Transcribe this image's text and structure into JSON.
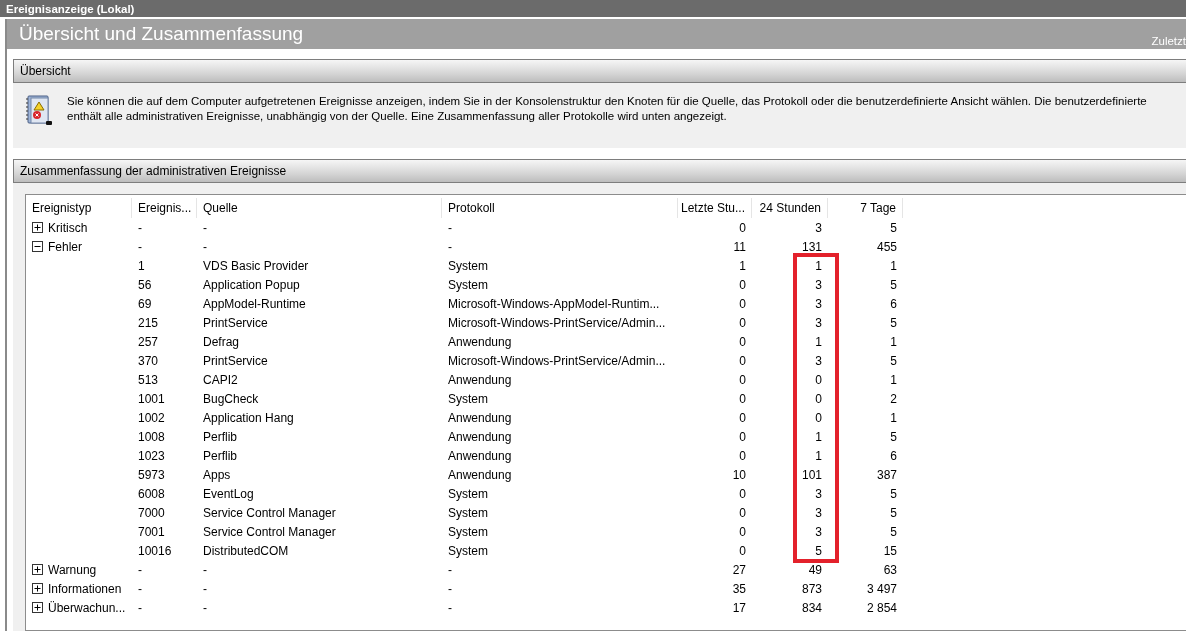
{
  "window": {
    "title": "Ereignisanzeige (Lokal)"
  },
  "panel": {
    "title": "Übersicht und Zusammenfassung",
    "last_refreshed": "Zuletzt"
  },
  "overview": {
    "title": "Übersicht",
    "lines": [
      "Sie können die auf dem Computer aufgetretenen Ereignisse anzeigen, indem Sie in der Konsolenstruktur den Knoten für die Quelle, das Protokoll oder die benutzerdefinierte Ansicht wählen. Die benutzerdefinierte",
      "enthält alle administrativen Ereignisse, unabhängig von der Quelle. Eine Zusammenfassung aller Protokolle wird unten angezeigt."
    ]
  },
  "summary": {
    "title": "Zusammenfassung der administrativen Ereignisse",
    "table": {
      "columns": [
        {
          "label": "Ereignistyp",
          "highlighted": false
        },
        {
          "label": "Ereignis...",
          "highlighted": false
        },
        {
          "label": "Quelle",
          "highlighted": false
        },
        {
          "label": "Protokoll",
          "highlighted": false
        },
        {
          "label": "Letzte Stu...",
          "highlighted": false
        },
        {
          "label": "24 Stunden",
          "highlighted": true
        },
        {
          "label": "7 Tage",
          "highlighted": false
        }
      ],
      "groups": [
        {
          "type": "Kritisch",
          "expanded": false,
          "cells": [
            "-",
            "-",
            "-",
            "0",
            "3",
            "5"
          ]
        },
        {
          "type": "Fehler",
          "expanded": true,
          "cells": [
            "-",
            "-",
            "-",
            "11",
            "131",
            "455"
          ],
          "children": [
            {
              "cells": [
                "1",
                "VDS Basic Provider",
                "System",
                "1",
                "1",
                "1"
              ]
            },
            {
              "cells": [
                "56",
                "Application Popup",
                "System",
                "0",
                "3",
                "5"
              ]
            },
            {
              "cells": [
                "69",
                "AppModel-Runtime",
                "Microsoft-Windows-AppModel-Runtim...",
                "0",
                "3",
                "6"
              ]
            },
            {
              "cells": [
                "215",
                "PrintService",
                "Microsoft-Windows-PrintService/Admin...",
                "0",
                "3",
                "5"
              ]
            },
            {
              "cells": [
                "257",
                "Defrag",
                "Anwendung",
                "0",
                "1",
                "1"
              ]
            },
            {
              "cells": [
                "370",
                "PrintService",
                "Microsoft-Windows-PrintService/Admin...",
                "0",
                "3",
                "5"
              ]
            },
            {
              "cells": [
                "513",
                "CAPI2",
                "Anwendung",
                "0",
                "0",
                "1"
              ]
            },
            {
              "cells": [
                "1001",
                "BugCheck",
                "System",
                "0",
                "0",
                "2"
              ]
            },
            {
              "cells": [
                "1002",
                "Application Hang",
                "Anwendung",
                "0",
                "0",
                "1"
              ]
            },
            {
              "cells": [
                "1008",
                "Perflib",
                "Anwendung",
                "0",
                "1",
                "5"
              ]
            },
            {
              "cells": [
                "1023",
                "Perflib",
                "Anwendung",
                "0",
                "1",
                "6"
              ]
            },
            {
              "cells": [
                "5973",
                "Apps",
                "Anwendung",
                "10",
                "101",
                "387"
              ]
            },
            {
              "cells": [
                "6008",
                "EventLog",
                "System",
                "0",
                "3",
                "5"
              ]
            },
            {
              "cells": [
                "7000",
                "Service Control Manager",
                "System",
                "0",
                "3",
                "5"
              ]
            },
            {
              "cells": [
                "7001",
                "Service Control Manager",
                "System",
                "0",
                "3",
                "5"
              ]
            },
            {
              "cells": [
                "10016",
                "DistributedCOM",
                "System",
                "0",
                "5",
                "15"
              ]
            }
          ]
        },
        {
          "type": "Warnung",
          "expanded": false,
          "cells": [
            "-",
            "-",
            "-",
            "27",
            "49",
            "63"
          ]
        },
        {
          "type": "Informationen",
          "expanded": false,
          "cells": [
            "-",
            "-",
            "-",
            "35",
            "873",
            "3 497"
          ]
        },
        {
          "type": "Überwachun...",
          "expanded": false,
          "cells": [
            "-",
            "-",
            "-",
            "17",
            "834",
            "2 854"
          ]
        }
      ]
    }
  }
}
